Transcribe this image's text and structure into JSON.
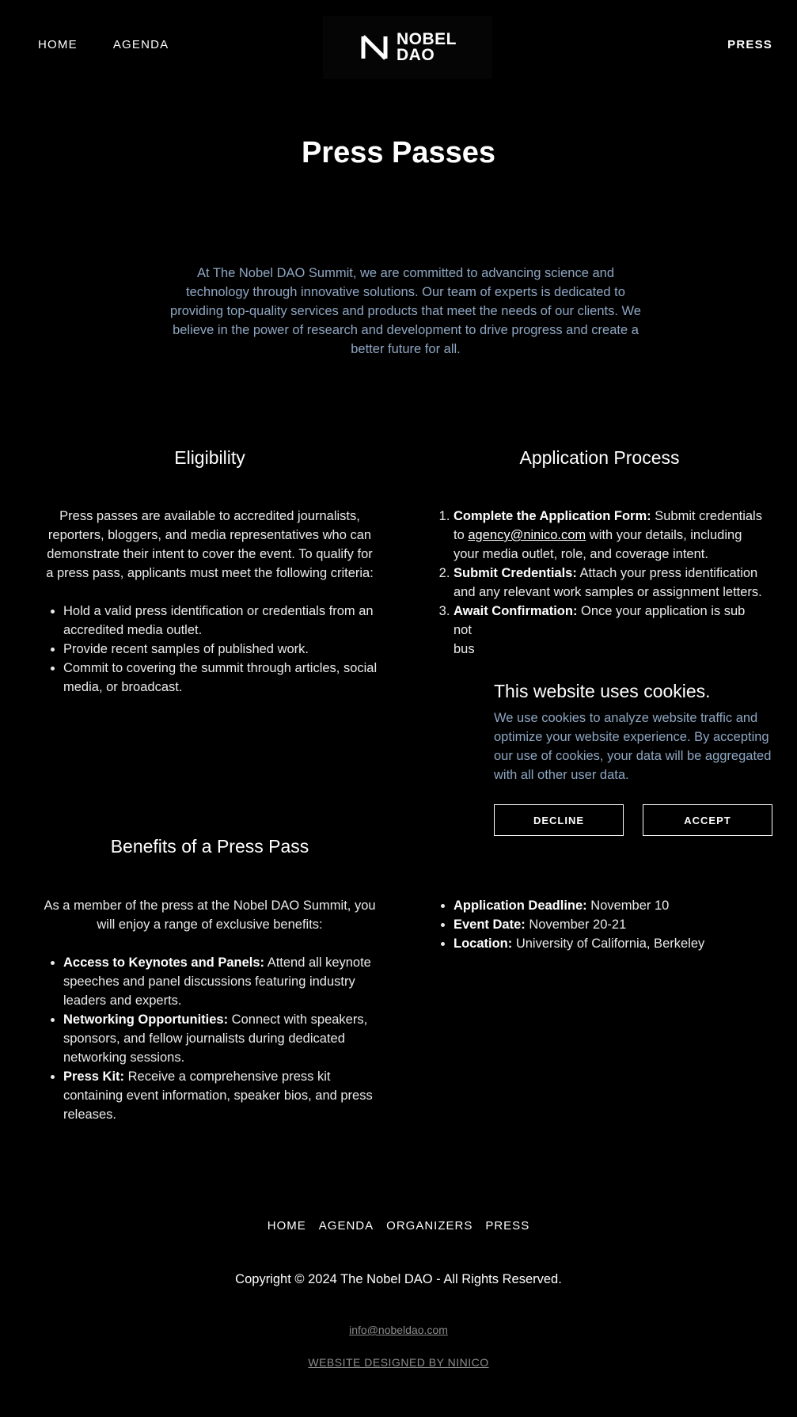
{
  "header": {
    "nav_left": [
      "HOME",
      "AGENDA"
    ],
    "logo": {
      "line1": "NOBEL",
      "line2": "DAO"
    },
    "nav_right": "PRESS"
  },
  "main": {
    "title": "Press Passes",
    "intro": "At The Nobel DAO Summit, we are committed to advancing science and technology through innovative solutions. Our team of experts is dedicated to providing top-quality services and products that meet the needs of our clients. We believe in the power of research and development to drive progress and create a better future for all."
  },
  "eligibility": {
    "heading": "Eligibility",
    "text": "Press passes are available to accredited journalists, reporters, bloggers, and media representatives who can demonstrate their intent to cover the event. To qualify for a press pass, applicants must meet the following criteria:",
    "criteria": [
      "Hold a valid press identification or credentials from an accredited media outlet.",
      "Provide recent samples of published work.",
      "Commit to covering the summit through articles, social media, or broadcast."
    ]
  },
  "application": {
    "heading": "Application Process",
    "steps": [
      {
        "title": "Complete the Application Form:",
        "pre": " Submit credentials to ",
        "link": "agency@ninico.com",
        "post": " with your details, including your media outlet, role, and coverage intent."
      },
      {
        "title": "Submit Credentials:",
        "text": " Attach your press identification and any relevant work samples or assignment letters."
      },
      {
        "title": "Await Confirmation:",
        "text": " Once your application is sub"
      },
      {
        "text": "not"
      },
      {
        "text": "bus"
      }
    ]
  },
  "benefits": {
    "heading": "Benefits of a Press Pass",
    "text": "As a member of the press at the Nobel DAO Summit, you will enjoy a range of exclusive benefits:",
    "items": [
      {
        "title": "Access to Keynotes and Panels:",
        "text": " Attend all keynote speeches and panel discussions featuring industry leaders and experts."
      },
      {
        "title": "Networking Opportunities:",
        "text": " Connect with speakers, sponsors, and fellow journalists during dedicated networking sessions."
      },
      {
        "title": "Press Kit:",
        "text": " Receive a comprehensive press kit containing event information, speaker bios, and press releases."
      }
    ]
  },
  "dates": [
    {
      "title": "Application Deadline:",
      "text": " November 10"
    },
    {
      "title": "Event Date:",
      "text": " November 20-21"
    },
    {
      "title": "Location:",
      "text": " University of California, Berkeley"
    }
  ],
  "cookie": {
    "title": "This website uses cookies.",
    "body": "We use cookies to analyze website traffic and optimize your website experience. By accepting our use of cookies, your data will be aggregated with all other user data.",
    "decline": "DECLINE",
    "accept": "ACCEPT"
  },
  "footer": {
    "nav": [
      "HOME",
      "AGENDA",
      "ORGANIZERS",
      "PRESS"
    ],
    "copyright": "Copyright © 2024 The Nobel DAO - All Rights Reserved.",
    "email": "info@nobeldao.com",
    "credit": "WEBSITE DESIGNED BY NINICO"
  }
}
